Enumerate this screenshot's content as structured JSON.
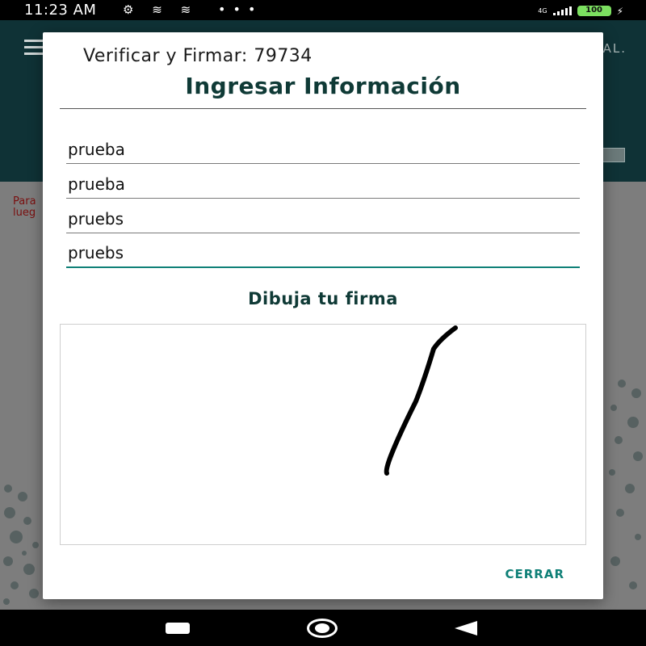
{
  "status_bar": {
    "time": "11:23 AM",
    "icons": [
      "settings-icon",
      "notification-icon",
      "notification-icon"
    ],
    "more": "• • •",
    "network": "4G",
    "battery": "100"
  },
  "background": {
    "logo_text": "AL.",
    "text_lines": [
      "Para",
      "lueg"
    ]
  },
  "dialog": {
    "top_title": "Verificar y Firmar: 79734",
    "title": "Ingresar Información",
    "fields": [
      {
        "value": "prueba"
      },
      {
        "value": "prueba"
      },
      {
        "value": "pruebs"
      },
      {
        "value": "pruebs"
      }
    ],
    "signature_label": "Dibuja tu firma",
    "close_label": "CERRAR"
  },
  "colors": {
    "accent": "#0f8077",
    "title": "#0f3a36"
  }
}
